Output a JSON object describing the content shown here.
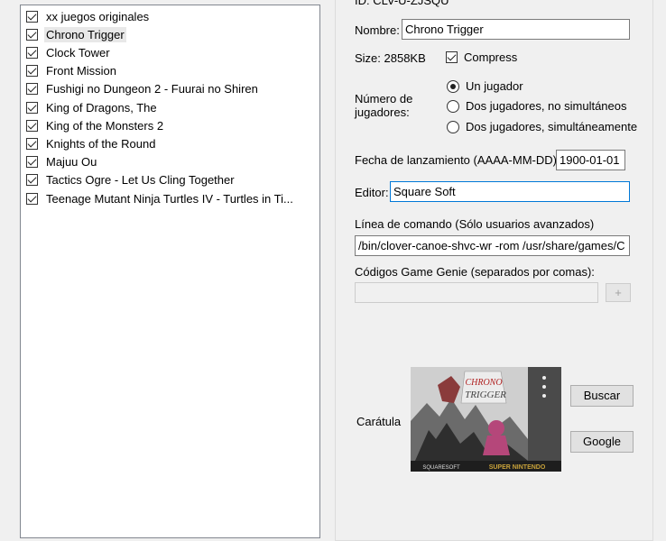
{
  "game_list": {
    "items": [
      {
        "label": "xx juegos originales",
        "checked": true
      },
      {
        "label": "Chrono Trigger",
        "checked": true,
        "selected": true
      },
      {
        "label": "Clock Tower",
        "checked": true
      },
      {
        "label": "Front Mission",
        "checked": true
      },
      {
        "label": "Fushigi no Dungeon 2 - Fuurai no Shiren",
        "checked": true
      },
      {
        "label": "King of Dragons, The",
        "checked": true
      },
      {
        "label": "King of the Monsters 2",
        "checked": true
      },
      {
        "label": "Knights of the Round",
        "checked": true
      },
      {
        "label": "Majuu Ou",
        "checked": true
      },
      {
        "label": "Tactics Ogre - Let Us Cling Together",
        "checked": true
      },
      {
        "label": "Teenage Mutant Ninja Turtles IV - Turtles in Ti...",
        "checked": true
      }
    ]
  },
  "details": {
    "id_label": "ID: CLV-U-ZJSQU",
    "name_label": "Nombre:",
    "name_value": "Chrono Trigger",
    "size_label": "Size: 2858KB",
    "compress_label": "Compress",
    "compress_checked": true,
    "players_label_line1": "Número de",
    "players_label_line2": "jugadores:",
    "players_options": [
      "Un jugador",
      "Dos jugadores, no simultáneos",
      "Dos jugadores, simultáneamente"
    ],
    "players_selected": 0,
    "release_label": "Fecha de lanzamiento (AAAA-MM-DD)",
    "release_value": "1900-01-01",
    "publisher_label": "Editor:",
    "publisher_value": "Square Soft",
    "cmdline_label": "Línea de comando (Sólo usuarios avanzados)",
    "cmdline_value": "/bin/clover-canoe-shvc-wr -rom /usr/share/games/C",
    "genie_label": "Códigos Game Genie (separados por comas):",
    "genie_value": "",
    "genie_button": "+",
    "cover_label": "Carátula",
    "search_button": "Buscar",
    "google_button": "Google",
    "cover_art": {
      "logo_line1": "CHRONO",
      "logo_line2": "TRIGGER",
      "publisher": "SQUARESOFT",
      "platform": "SUPER NINTENDO"
    }
  }
}
